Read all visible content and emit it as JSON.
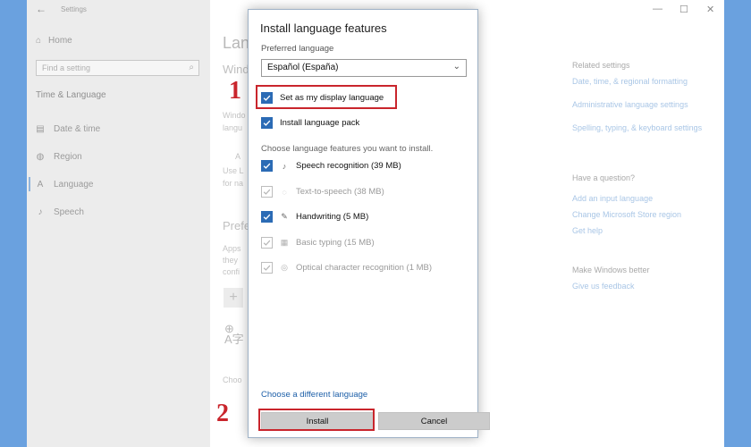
{
  "settings": {
    "window_title": "Settings",
    "back_icon": "back-arrow-icon",
    "window_controls": {
      "minimize": "—",
      "maximize": "☐",
      "close": "✕"
    },
    "sidebar": {
      "home": "Home",
      "search_placeholder": "Find a setting",
      "section": "Time & Language",
      "items": [
        {
          "label": "Date & time",
          "icon": "calendar-clock-icon"
        },
        {
          "label": "Region",
          "icon": "globe-icon"
        },
        {
          "label": "Language",
          "icon": "language-icon"
        },
        {
          "label": "Speech",
          "icon": "microphone-icon"
        }
      ]
    },
    "main": {
      "heading": "Lan",
      "windows_heading": "Wind",
      "frag_windo": "Windo",
      "frag_langu": "langu",
      "frag_a": "A",
      "frag_use": "Use L",
      "frag_forna": "for na",
      "pref_heading": "Prefe",
      "frag_apps": "Apps",
      "frag_they": "they",
      "frag_config": "confi",
      "frag_choo": "Choo"
    },
    "related": {
      "title": "Related settings",
      "links": [
        "Date, time, & regional formatting",
        "Administrative language settings",
        "Spelling, typing, & keyboard settings"
      ],
      "question_title": "Have a question?",
      "question_links": [
        "Add an input language",
        "Change Microsoft Store region",
        "Get help"
      ],
      "better_title": "Make Windows better",
      "better_link": "Give us feedback"
    }
  },
  "dialog": {
    "title": "Install language features",
    "preferred_label": "Preferred language",
    "preferred_value": "Español (España)",
    "options": [
      {
        "label": "Set as my display language",
        "checked": true
      },
      {
        "label": "Install language pack",
        "checked": true
      }
    ],
    "features_label": "Choose language features you want to install.",
    "features": [
      {
        "label": "Speech recognition (39 MB)",
        "checked": true,
        "enabled": true,
        "icon": "microphone-icon"
      },
      {
        "label": "Text-to-speech (38 MB)",
        "checked": true,
        "enabled": false,
        "icon": "speech-bubble-icon"
      },
      {
        "label": "Handwriting (5 MB)",
        "checked": true,
        "enabled": true,
        "icon": "pen-icon"
      },
      {
        "label": "Basic typing (15 MB)",
        "checked": true,
        "enabled": false,
        "icon": "keyboard-icon"
      },
      {
        "label": "Optical character recognition (1 MB)",
        "checked": true,
        "enabled": false,
        "icon": "scan-icon"
      }
    ],
    "different_language_link": "Choose a different language",
    "install_button": "Install",
    "cancel_button": "Cancel"
  },
  "annotations": {
    "step1": "1",
    "step2": "2",
    "highlight_color": "#c9252c"
  },
  "colors": {
    "accent": "#2b6bb5",
    "link": "#1d5fa8",
    "frame": "#6aa1df"
  }
}
